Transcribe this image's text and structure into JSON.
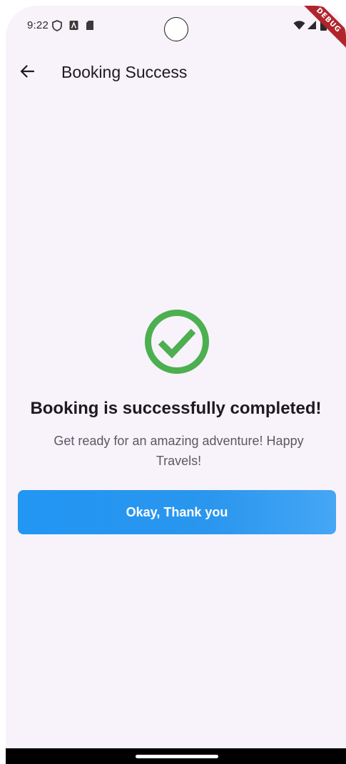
{
  "status_bar": {
    "time": "9:22",
    "icons": [
      "shield-icon",
      "a-icon",
      "sd-card-icon",
      "wifi-icon",
      "signal-icon",
      "battery-icon"
    ],
    "debug_label": "DEBUG"
  },
  "app_bar": {
    "back_icon": "arrow-back-icon",
    "title": "Booking Success"
  },
  "content": {
    "status_icon": "check-circle-icon",
    "headline": "Booking is successfully completed!",
    "message": "Get ready for an amazing adventure! Happy Travels!",
    "button_label": "Okay, Thank you"
  },
  "colors": {
    "background": "#f8f2fb",
    "success": "#4caf50",
    "primary": "#2196f3",
    "debug": "#b0252c"
  }
}
